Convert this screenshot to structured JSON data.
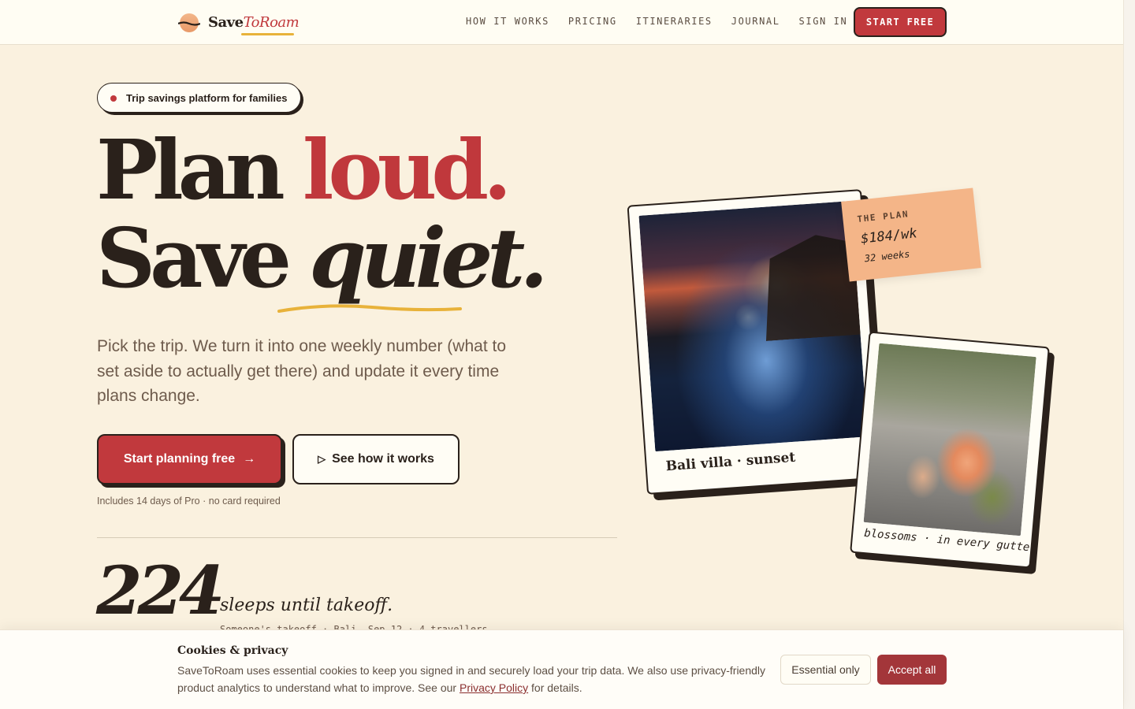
{
  "brand": {
    "name_main": "Save",
    "name_accent": "ToRoam",
    "colors": {
      "primary": "#c1393d",
      "ink": "#2a211b",
      "background": "#faf1df",
      "highlight": "#e8b23a",
      "note": "#f4b588"
    },
    "logo_icon": "sunset-icon"
  },
  "nav": {
    "links": [
      "HOW IT WORKS",
      "PRICING",
      "ITINERARIES",
      "JOURNAL",
      "SIGN IN"
    ],
    "cta": "START FREE"
  },
  "hero": {
    "pill": "Trip savings platform for families",
    "headline_line1_a": "Plan ",
    "headline_line1_b": "loud.",
    "headline_line2_a": "Save ",
    "headline_line2_b": "quiet.",
    "subtext": "Pick the trip. We turn it into one weekly number (what to set aside to actually get there) and update it every time plans change.",
    "primary_button": "Start planning free",
    "primary_button_arrow": "→",
    "secondary_button_icon": "▷",
    "secondary_button": "See how it works",
    "fineprint": "Includes 14 days of Pro · no card required"
  },
  "countdown": {
    "value": "224",
    "label": "sleeps until takeoff.",
    "sub": "Someone's takeoff · Bali, Sep 12 · 4 travellers"
  },
  "collage": {
    "photo1_caption": "Bali villa · sunset",
    "photo2_caption": "blossoms · in every gutter",
    "note": {
      "label": "THE PLAN",
      "price": "$184/wk",
      "weeks": "32 weeks"
    }
  },
  "cookie": {
    "title": "Cookies & privacy",
    "text_before": "SaveToRoam uses essential cookies to keep you signed in and securely load your trip data. We also use privacy-friendly product analytics to understand what to improve. See our ",
    "link": "Privacy Policy",
    "text_after": " for details.",
    "essential_button": "Essential only",
    "accept_button": "Accept all"
  }
}
